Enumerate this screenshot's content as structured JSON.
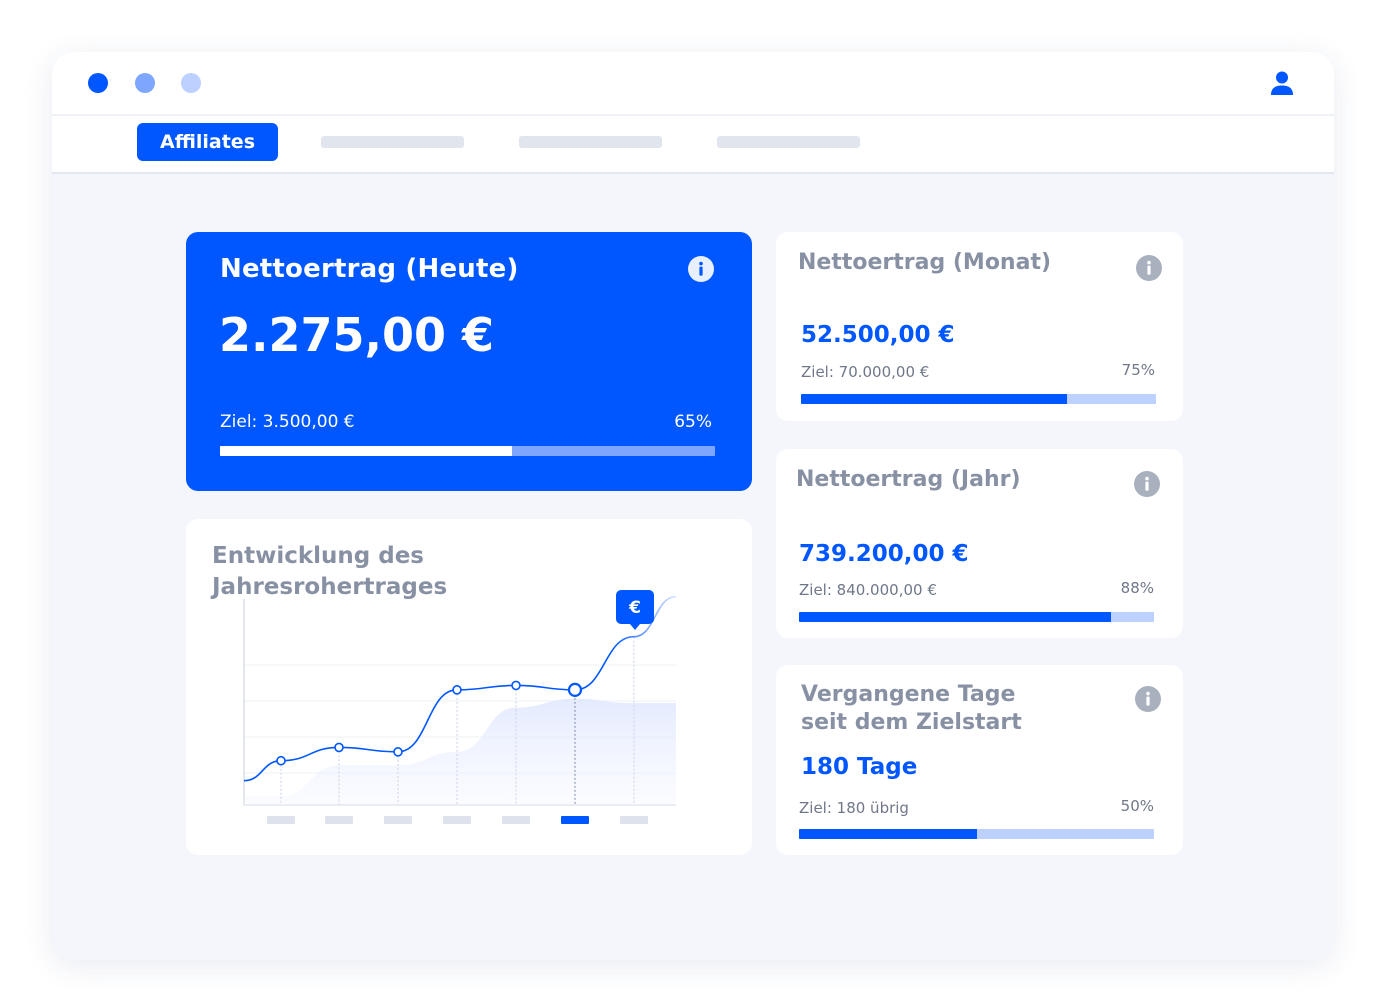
{
  "window": {
    "controls": [
      "close",
      "minimize",
      "maximize"
    ],
    "user_icon": "user-icon"
  },
  "nav": {
    "active_tab": "Affiliates",
    "placeholder_tabs": 3
  },
  "today": {
    "title": "Nettoertrag (Heute)",
    "value": "2.275,00 €",
    "goal": "Ziel: 3.500,00 €",
    "percent_label": "65%",
    "progress": 0.59,
    "info_icon": "info-icon"
  },
  "month": {
    "title": "Nettoertrag (Monat)",
    "value": "52.500,00 €",
    "goal": "Ziel: 70.000,00 €",
    "percent_label": "75%",
    "progress": 0.75,
    "info_icon": "info-icon"
  },
  "year": {
    "title": "Nettoertrag (Jahr)",
    "value": "739.200,00 €",
    "goal": "Ziel: 840.000,00 €",
    "percent_label": "88%",
    "progress": 0.88,
    "info_icon": "info-icon"
  },
  "days": {
    "title_line1": "Vergangene Tage",
    "title_line2": "seit dem Zielstart",
    "value": "180 Tage",
    "goal": "Ziel: 180 übrig",
    "percent_label": "50%",
    "progress": 0.5,
    "info_icon": "info-icon"
  },
  "chart": {
    "title_line1": "Entwicklung des",
    "title_line2": "Jahresrohertrages",
    "badge": "€",
    "colors": {
      "line": "#0057ff",
      "accent": "#0057ff",
      "muted": "#dde2ec"
    },
    "chart_data": {
      "type": "line",
      "title": "Entwicklung des Jahresrohertrages",
      "categories": [
        "",
        "",
        "",
        "",
        "",
        "",
        ""
      ],
      "highlighted_index": 5,
      "series": [
        {
          "values": [
            1.0,
            1.3,
            1.2,
            2.6,
            2.7,
            2.6,
            3.8
          ],
          "style": "line-with-markers"
        },
        {
          "values": [
            0.2,
            0.9,
            0.9,
            1.2,
            2.2,
            2.4,
            2.3
          ],
          "style": "shaded-area"
        }
      ],
      "grid": true,
      "legend": "none"
    }
  }
}
